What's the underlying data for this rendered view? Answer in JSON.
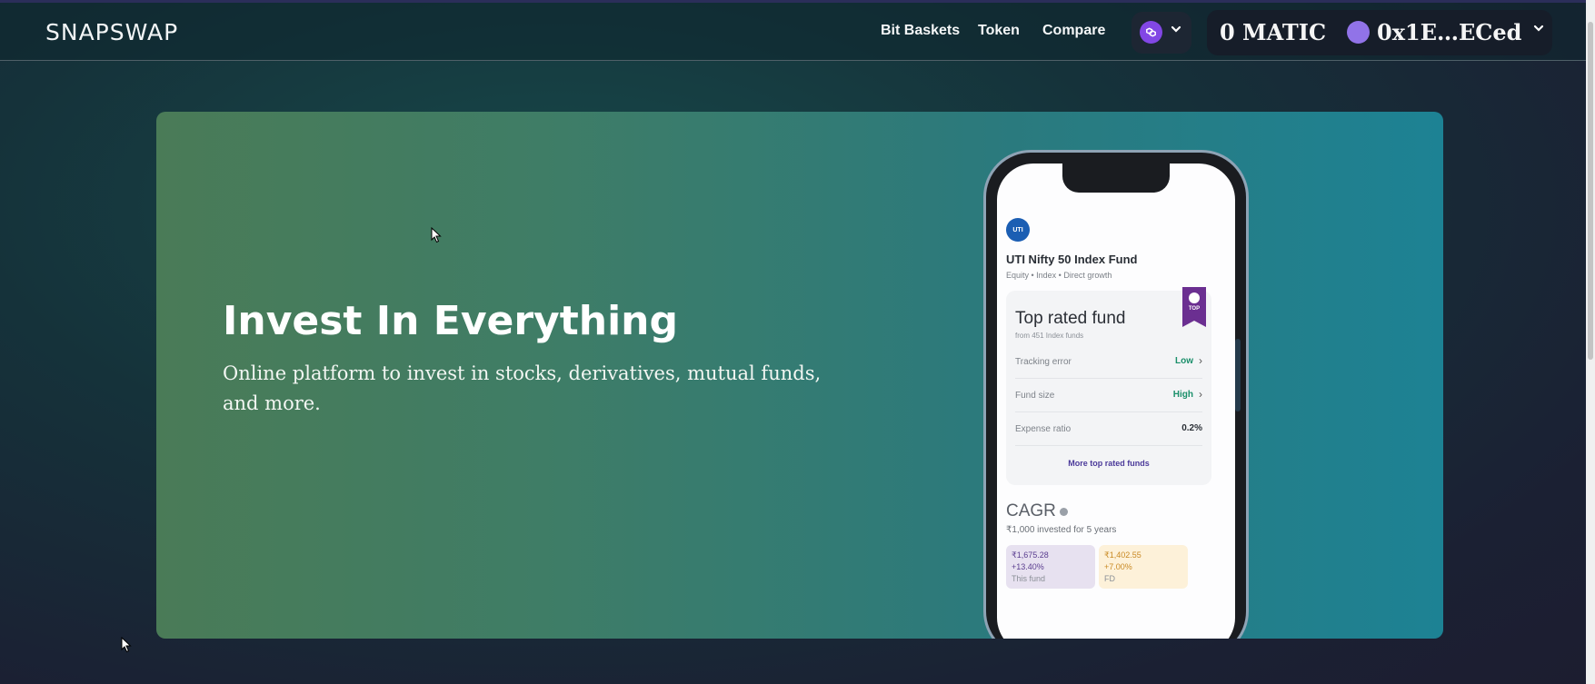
{
  "brand": "SNAPSWAP",
  "nav": {
    "links": [
      "Bit Baskets",
      "Token",
      "Compare"
    ]
  },
  "wallet": {
    "balance": "0 MATIC",
    "address": "0x1E…ECed"
  },
  "hero": {
    "title": "Invest In Everything",
    "subtitle": "Online platform to invest in stocks, derivatives, mutual funds, and more."
  },
  "phone": {
    "logo_text": "UTI",
    "fund_name": "UTI Nifty 50 Index Fund",
    "fund_tags": "Equity • Index • Direct growth",
    "card_title": "Top rated fund",
    "card_from": "from 451 Index funds",
    "badge_text": "TOP",
    "rows": [
      {
        "label": "Tracking error",
        "value": "Low"
      },
      {
        "label": "Fund size",
        "value": "High"
      },
      {
        "label": "Expense ratio",
        "value": "0.2%"
      }
    ],
    "more_link": "More top rated funds",
    "cagr_title": "CAGR",
    "cagr_sub": "₹1,000 invested for 5 years",
    "box1": {
      "amount": "₹1,675.28",
      "pct": "+13.40%",
      "label": "This fund"
    },
    "box2": {
      "amount": "₹1,402.55",
      "pct": "+7.00%",
      "label": "FD"
    }
  },
  "colors": {
    "accent_purple": "#8247e5",
    "hero_start": "#4a7b57",
    "hero_end": "#1d8294"
  }
}
